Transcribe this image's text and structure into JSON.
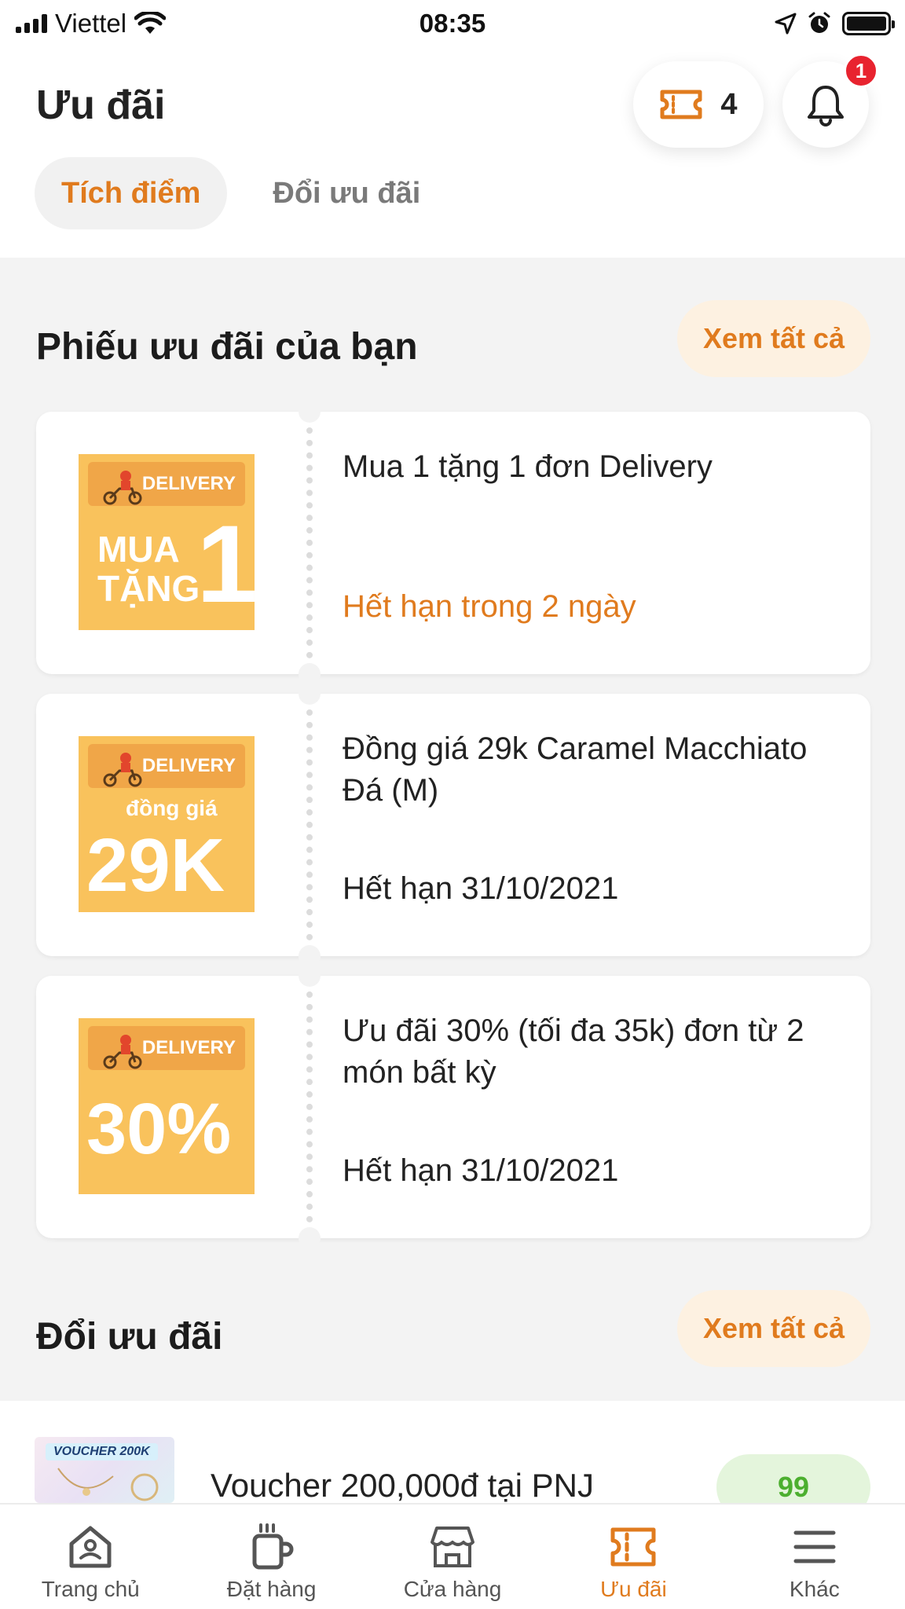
{
  "status_bar": {
    "carrier": "Viettel",
    "time": "08:35"
  },
  "header": {
    "title": "Ưu đãi",
    "voucher_count": "4",
    "notification_badge": "1",
    "tabs": [
      {
        "label": "Tích điểm",
        "active": true
      },
      {
        "label": "Đổi ưu đãi",
        "active": false
      }
    ]
  },
  "my_vouchers": {
    "title": "Phiếu ưu đãi của bạn",
    "see_all": "Xem tất cả",
    "items": [
      {
        "image_tag": "DELIVERY",
        "image_line1": "MUA",
        "image_line2": "TẶNG",
        "image_big": "1",
        "title": "Mua 1 tặng 1 đơn Delivery",
        "expiry": "Hết hạn trong 2 ngày"
      },
      {
        "image_tag": "DELIVERY",
        "image_line1": "đồng giá",
        "image_big": "29K",
        "title": "Đồng giá 29k Caramel Macchiato Đá (M)",
        "expiry": "Hết hạn 31/10/2021"
      },
      {
        "image_tag": "DELIVERY",
        "image_big": "30%",
        "title": "Ưu đãi 30% (tối đa 35k) đơn từ 2 món bất kỳ",
        "expiry": "Hết hạn 31/10/2021"
      }
    ]
  },
  "redeem": {
    "title": "Đổi ưu đãi",
    "see_all": "Xem tất cả",
    "items": [
      {
        "image_tag": "VOUCHER 200K",
        "title": "Voucher 200,000đ tại PNJ",
        "points": "99"
      }
    ]
  },
  "bottom_nav": {
    "items": [
      {
        "label": "Trang chủ",
        "icon": "home-icon",
        "active": false
      },
      {
        "label": "Đặt hàng",
        "icon": "coffee-cup-icon",
        "active": false
      },
      {
        "label": "Cửa hàng",
        "icon": "store-icon",
        "active": false
      },
      {
        "label": "Ưu đãi",
        "icon": "ticket-icon",
        "active": true
      },
      {
        "label": "Khác",
        "icon": "menu-icon",
        "active": false
      }
    ]
  },
  "colors": {
    "accent": "#e07b1e",
    "badge": "#e8232f",
    "voucher_bg": "#f9c25c",
    "points_green": "#4caf2f"
  }
}
